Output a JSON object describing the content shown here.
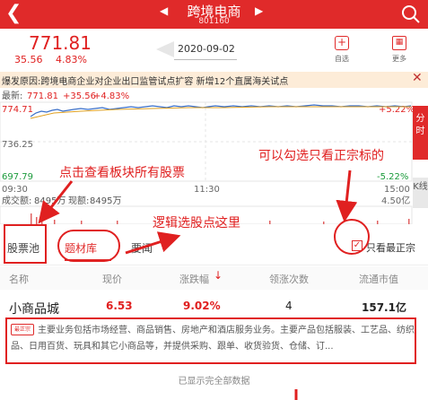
{
  "header": {
    "title": "跨境电商",
    "code": "801160",
    "back_icon": "chevron-left-icon",
    "search_icon": "search-icon",
    "prev_icon": "triangle-left-icon",
    "next_icon": "triangle-right-icon",
    "bg_color": "#e02a2a"
  },
  "quote": {
    "price": "771.81",
    "change": "35.56",
    "percent": "4.83%",
    "date": "2020-09-02",
    "favorite_label": "自选",
    "more_label": "更多"
  },
  "banner": {
    "text": "爆发原因:跨境电商企业对企业出口监管试点扩容 新增12个直属海关试点",
    "close_icon": "close-icon"
  },
  "chart": {
    "legend_latest_label": "最新:",
    "legend_latest_value": "771.81",
    "legend_change": "+35.56",
    "legend_pct": "+4.83%",
    "y_top": "774.71",
    "y_mid": "736.25",
    "y_bottom": "697.79",
    "pct_top": "+5.22%",
    "pct_bottom": "-5.22%",
    "time_start": "09:30",
    "time_mid": "11:30",
    "time_end": "15:00",
    "vol_label": "成交额:",
    "vol_value": "8495万",
    "now_label": "现额:",
    "now_value": "8495万",
    "vol_max": "4.50亿",
    "side_tab_1": "分时",
    "side_tab_2": "K线"
  },
  "tabs": {
    "pool": "股票池",
    "concept": "题材库",
    "map": "要闻",
    "checkbox_label": "只看最正宗"
  },
  "columns": [
    "名称",
    "现价",
    "涨跌幅",
    "领涨次数",
    "流通市值"
  ],
  "row": {
    "name": "小商品城",
    "price": "6.53",
    "pct": "9.02%",
    "count": "4",
    "cap": "157.1亿",
    "badge": "最正宗",
    "desc": "主要业务包括市场经营、商品销售、房地产和酒店服务业务。主要产品包括服装、工艺品、纺织品、日用百货、玩具和其它小商品等，并提供采购、跟单、收货验货、仓储、订..."
  },
  "footer": "已显示完全部数据",
  "annotations": {
    "view_all": "点击查看板块所有股票",
    "check_tip": "可以勾选只看正宗标的",
    "logic_tip": "逻辑选股点这里"
  },
  "colors": {
    "up": "#e02020",
    "down": "#1a9a3a",
    "annotation": "#e02020"
  }
}
